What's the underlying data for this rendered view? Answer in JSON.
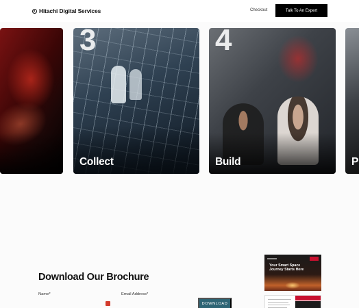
{
  "header": {
    "brand": "Hitachi Digital Services",
    "checkout_label": "Checkout",
    "cta_label": "Talk To An Expert"
  },
  "cards": [
    {
      "number": "",
      "label": ""
    },
    {
      "number": "3",
      "label": "Collect"
    },
    {
      "number": "4",
      "label": "Build"
    },
    {
      "number": "",
      "label": "P"
    }
  ],
  "brochure_section": {
    "title": "Download Our Brochure",
    "name_label": "Name*",
    "email_label": "Email Address*",
    "download_label": "DOWNLOAD",
    "preview_title": "Your Smart Space Journey Starts Here"
  },
  "colors": {
    "cta_background": "#000000",
    "download_button": "#2e6575",
    "accent_red": "#c8102e"
  }
}
